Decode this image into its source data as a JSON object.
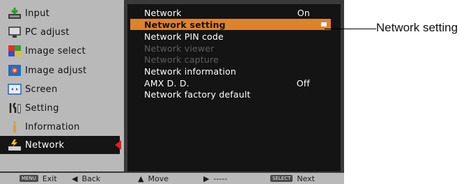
{
  "sidebar": {
    "items": [
      {
        "label": "Input",
        "icon": "input-icon"
      },
      {
        "label": "PC adjust",
        "icon": "pc-adjust-icon"
      },
      {
        "label": "Image select",
        "icon": "image-select-icon"
      },
      {
        "label": "Image adjust",
        "icon": "image-adjust-icon"
      },
      {
        "label": "Screen",
        "icon": "screen-icon"
      },
      {
        "label": "Setting",
        "icon": "setting-icon"
      },
      {
        "label": "Information",
        "icon": "information-icon"
      },
      {
        "label": "Network",
        "icon": "network-icon",
        "active": true
      }
    ]
  },
  "menu": {
    "rows": [
      {
        "label": "Network",
        "value": "On"
      },
      {
        "label": "Network setting",
        "selected": true
      },
      {
        "label": "Network PIN code"
      },
      {
        "label": "Network viewer",
        "disabled": true
      },
      {
        "label": "Network capture",
        "disabled": true
      },
      {
        "label": "Network information"
      },
      {
        "label": "AMX D. D.",
        "value": "Off"
      },
      {
        "label": "Network factory default"
      }
    ]
  },
  "bottom": {
    "exit_key": "MENU",
    "exit_label": "Exit",
    "back_label": "Back",
    "move_label": "Move",
    "right_label": "-----",
    "next_key": "SELECT",
    "next_label": "Next"
  },
  "callout": {
    "text": "Network setting"
  },
  "colors": {
    "sidebar_bg": "#b9b9b9",
    "menu_bg": "#141414",
    "selected_row": "#e0822a",
    "active_arrow": "#e02020",
    "disabled_text": "#5e5e5e"
  }
}
